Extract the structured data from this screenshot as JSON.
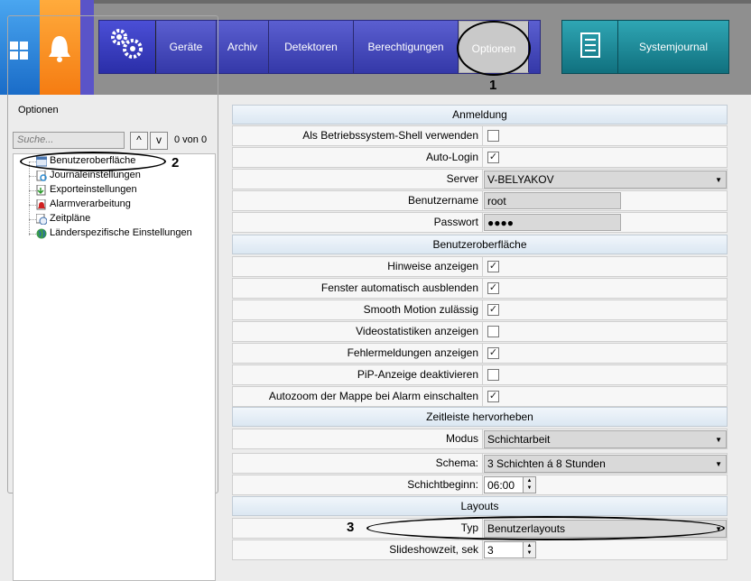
{
  "toolbar": {
    "tabs": [
      "Geräte",
      "Archiv",
      "Detektoren",
      "Berechtigungen",
      "Optionen"
    ],
    "selected": "Optionen",
    "systemjournal": "Systemjournal"
  },
  "annotations": [
    "1",
    "2",
    "3"
  ],
  "left": {
    "group_title": "Optionen",
    "search_placeholder": "Suche...",
    "up": "^",
    "down": "v",
    "count": "0 von 0",
    "tree": [
      "Benutzeroberfläche",
      "Journaleinstellungen",
      "Exporteinstellungen",
      "Alarmverarbeitung",
      "Zeitpläne",
      "Länderspezifische Einstellungen"
    ]
  },
  "sections": {
    "anmeldung": "Anmeldung",
    "ui": "Benutzeroberfläche",
    "timeline": "Zeitleiste hervorheben",
    "layouts": "Layouts"
  },
  "anmeldung": {
    "shell_label": "Als Betriebssystem-Shell verwenden",
    "shell_checked": false,
    "autologin_label": "Auto-Login",
    "autologin_checked": true,
    "server_label": "Server",
    "server_value": "V-BELYAKOV",
    "user_label": "Benutzername",
    "user_value": "root",
    "pass_label": "Passwort",
    "pass_value": "●●●●"
  },
  "ui_options": [
    {
      "label": "Hinweise anzeigen",
      "checked": true
    },
    {
      "label": "Fenster automatisch ausblenden",
      "checked": true
    },
    {
      "label": "Smooth Motion zulässig",
      "checked": true
    },
    {
      "label": "Videostatistiken anzeigen",
      "checked": false
    },
    {
      "label": "Fehlermeldungen anzeigen",
      "checked": true
    },
    {
      "label": "PiP-Anzeige deaktivieren",
      "checked": false
    },
    {
      "label": "Autozoom der Mappe bei Alarm einschalten",
      "checked": true
    }
  ],
  "timeline": {
    "modus_label": "Modus",
    "modus_value": "Schichtarbeit",
    "schema_label": "Schema:",
    "schema_value": "3 Schichten á 8 Stunden",
    "begin_label": "Schichtbeginn:",
    "begin_value": "06:00"
  },
  "layouts": {
    "typ_label": "Typ",
    "typ_value": "Benutzerlayouts",
    "slide_label": "Slideshowzeit, sek",
    "slide_value": "3"
  },
  "colors": {
    "accent_blue": "#3438a8",
    "teal": "#10707e",
    "orange": "#f57c12"
  }
}
